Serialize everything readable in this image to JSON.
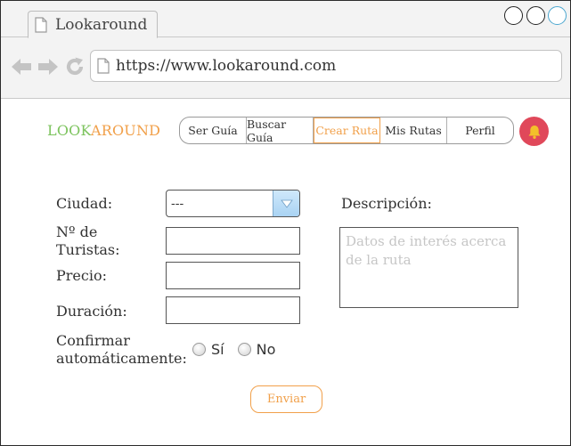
{
  "browser": {
    "tab_title": "Lookaround",
    "url": "https://www.lookaround.com"
  },
  "header": {
    "logo_part1": "LOOK",
    "logo_part2": "AROUND",
    "nav": [
      {
        "label": "Ser Guía"
      },
      {
        "label": "Buscar Guía"
      },
      {
        "label": "Crear Ruta",
        "active": true
      },
      {
        "label": "Mis Rutas"
      },
      {
        "label": "Perfil"
      }
    ],
    "notification_icon": "bell-icon"
  },
  "form": {
    "city_label": "Ciudad:",
    "city_value": "---",
    "tourists_label_line1": "Nº de",
    "tourists_label_line2": "Turistas:",
    "tourists_value": "",
    "price_label": "Precio:",
    "price_value": "",
    "duration_label": "Duración:",
    "duration_value": "",
    "confirm_label_line1": "Confirmar",
    "confirm_label_line2": "automáticamente:",
    "radio_yes": "Sí",
    "radio_no": "No",
    "description_label": "Descripción:",
    "description_placeholder": "Datos de interés acerca de la ruta",
    "submit_label": "Enviar"
  },
  "colors": {
    "logo_green": "#7cc35d",
    "accent_orange": "#f1a04a",
    "bell_red": "#e0485a"
  }
}
